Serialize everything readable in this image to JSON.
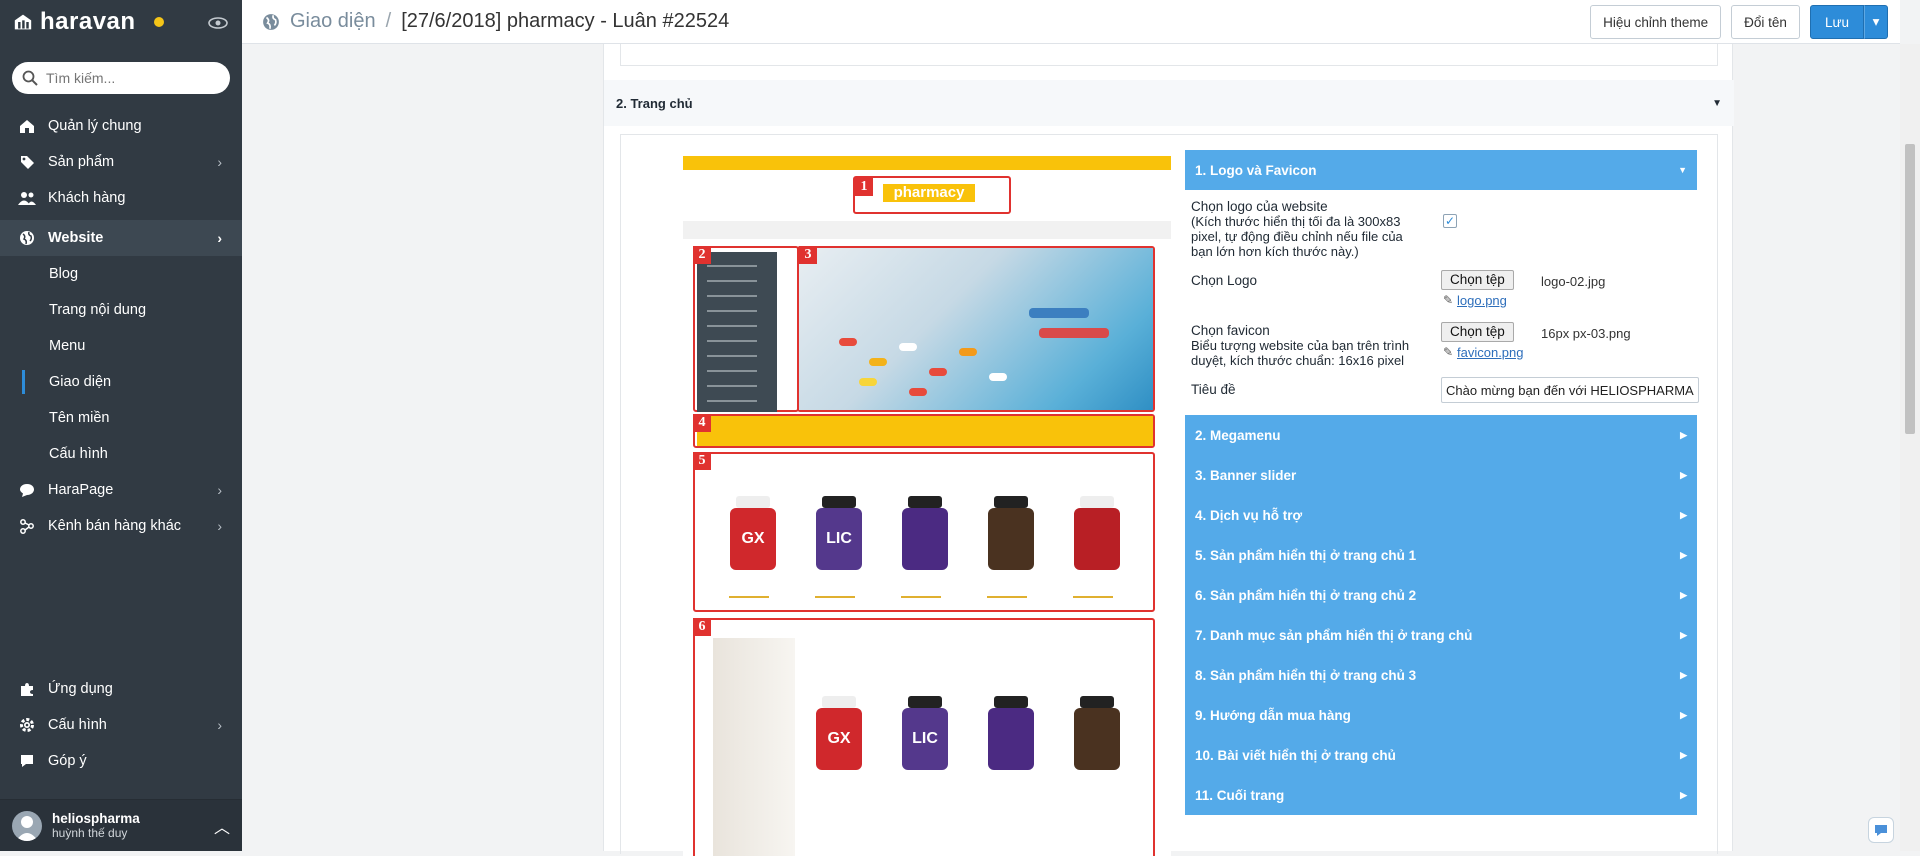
{
  "brand": {
    "name": "haravan"
  },
  "search": {
    "placeholder": "Tìm kiếm..."
  },
  "sidebar": {
    "items": [
      {
        "label": "Quản lý chung"
      },
      {
        "label": "Sản phẩm"
      },
      {
        "label": "Khách hàng"
      },
      {
        "label": "Website"
      },
      {
        "label": "HaraPage"
      },
      {
        "label": "Kênh bán hàng khác"
      }
    ],
    "website_sub": [
      "Blog",
      "Trang nội dung",
      "Menu",
      "Giao diện",
      "Tên miền",
      "Cấu hình"
    ],
    "bottom": [
      {
        "label": "Ứng dụng"
      },
      {
        "label": "Cấu hình"
      },
      {
        "label": "Góp ý"
      }
    ],
    "user": {
      "name": "heliospharma",
      "subtitle": "huỳnh thế duy"
    }
  },
  "header": {
    "crumb_root": "Giao diện",
    "crumb_sep": "/",
    "title": "[27/6/2018] pharmacy - Luân #22524",
    "btn_edit": "Hiệu chỉnh theme",
    "btn_rename": "Đổi tên",
    "btn_save": "Lưu"
  },
  "section": {
    "title": "2. Trang chủ"
  },
  "preview": {
    "logo_text": "pharmacy",
    "markers": [
      "1",
      "2",
      "3",
      "4",
      "5",
      "6"
    ]
  },
  "accordion": {
    "open_title": "1. Logo và Favicon",
    "form": {
      "logo_web_label": "Chọn logo của website",
      "logo_web_help": "(Kích thước hiển thị tối đa là 300x83 pixel, tự động điều chỉnh nếu file của bạn lớn hơn kích thước này.)",
      "logo_web_checked": true,
      "logo_label": "Chọn Logo",
      "logo_btn": "Chọn tệp",
      "logo_file": "logo-02.jpg",
      "logo_link": "logo.png",
      "favicon_label": "Chọn favicon",
      "favicon_help": "Biểu tượng website của bạn trên trình duyệt, kích thước chuẩn: 16x16 pixel",
      "favicon_btn": "Chọn tệp",
      "favicon_file": "16px px-03.png",
      "favicon_link": "favicon.png",
      "title_label": "Tiêu đề",
      "title_value": "Chào mừng bạn đến với HELIOSPHARMA"
    },
    "sections": [
      "2. Megamenu",
      "3. Banner slider",
      "4. Dịch vụ hỗ trợ",
      "5. Sản phẩm hiển thị ở trang chủ 1",
      "6. Sản phẩm hiển thị ở trang chủ 2",
      "7. Danh mục sản phẩm hiển thị ở trang chủ",
      "8. Sản phẩm hiển thị ở trang chủ 3",
      "9. Hướng dẫn mua hàng",
      "10. Bài viết hiển thị ở trang chủ",
      "11. Cuối trang"
    ]
  },
  "colors": {
    "sidebar": "#313a43",
    "accent": "#2d8cd9",
    "accordion": "#54aae9",
    "marker": "#e0322f",
    "brand_yellow": "#f9c20a"
  }
}
